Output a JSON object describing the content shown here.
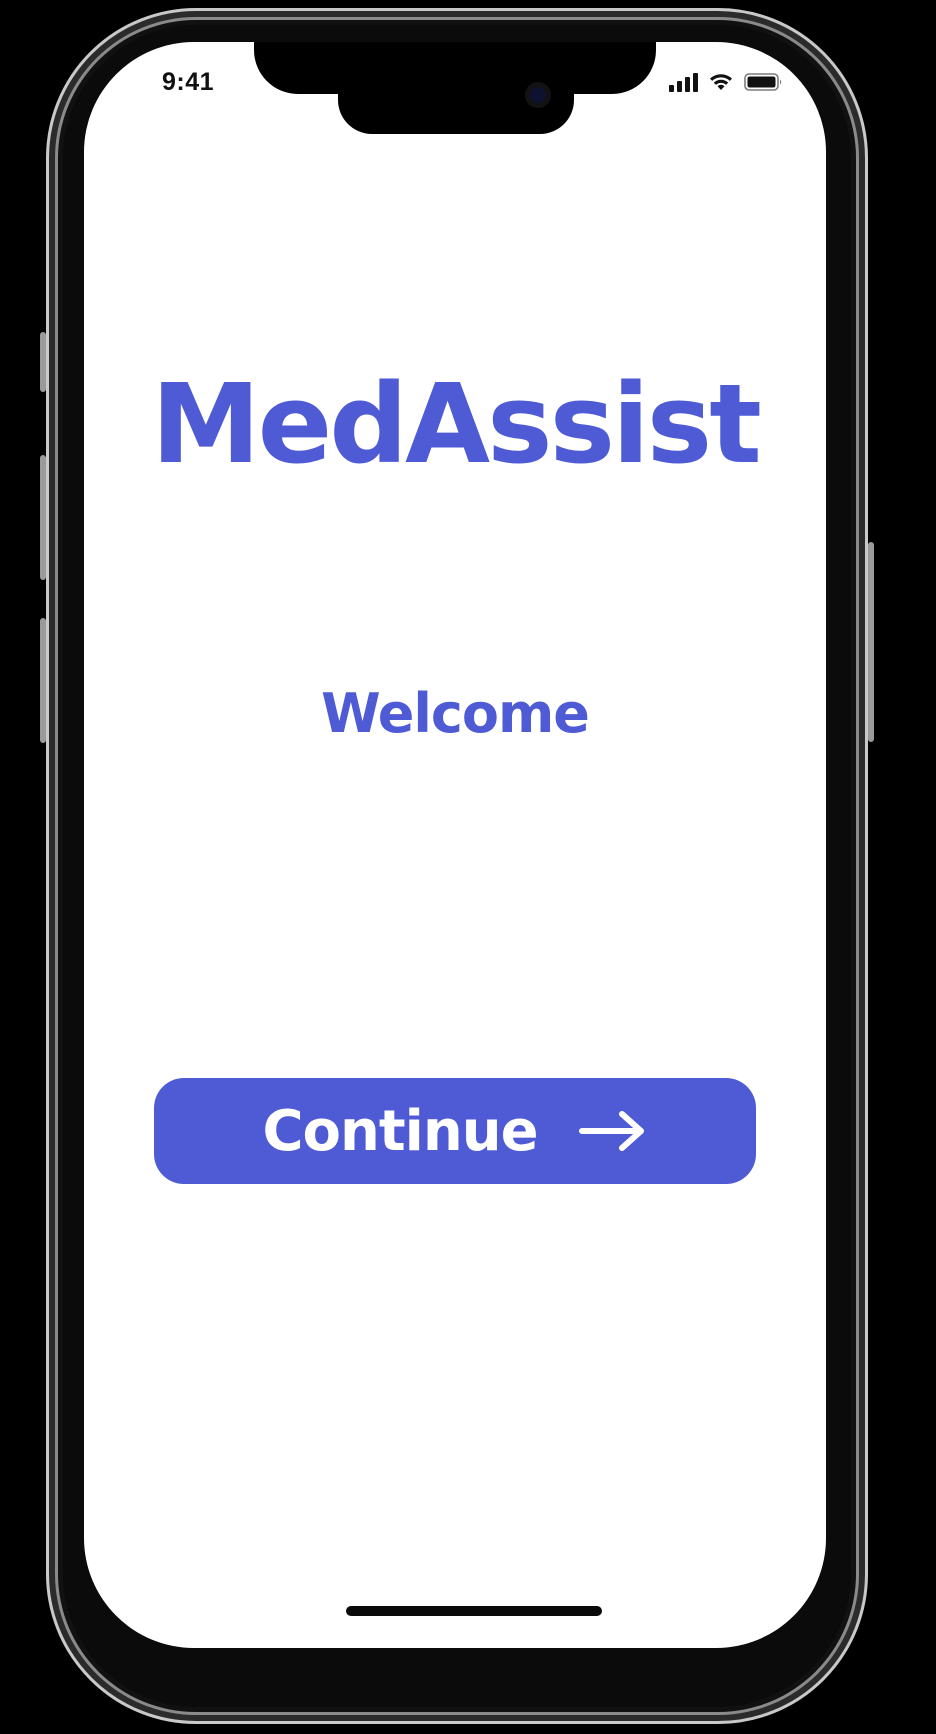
{
  "status_bar": {
    "time": "9:41",
    "icons": [
      "signal-icon",
      "wifi-icon",
      "battery-icon"
    ]
  },
  "app": {
    "logo_text": "MedAssist",
    "welcome": "Welcome",
    "continue_label": "Continue",
    "continue_icon": "arrow-right-icon"
  },
  "colors": {
    "brand": "#4f5bd5",
    "background": "#ffffff",
    "button_text": "#ffffff"
  }
}
